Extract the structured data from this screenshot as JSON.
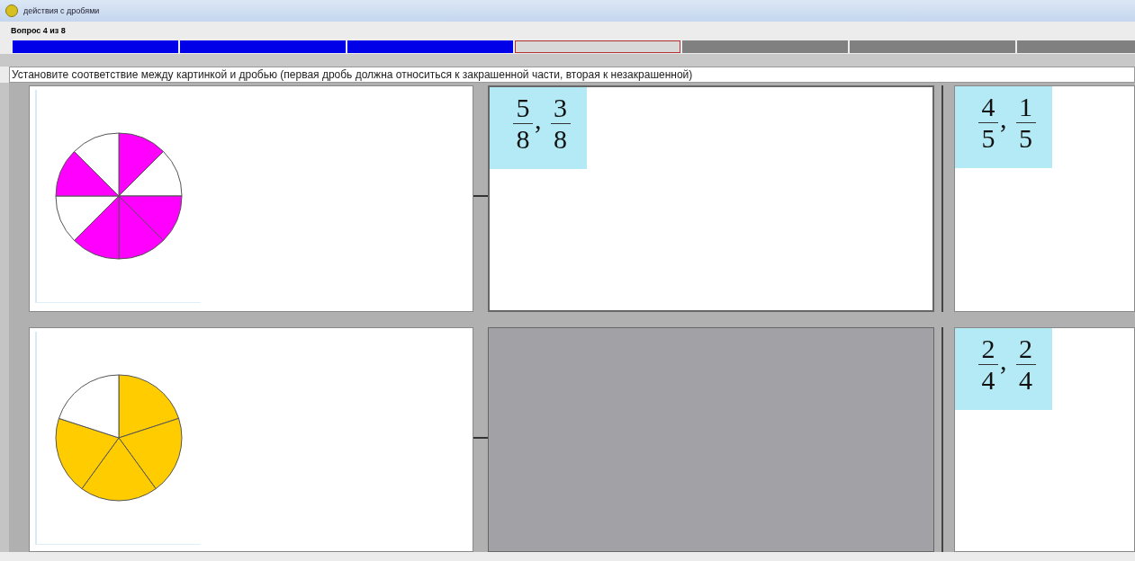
{
  "window": {
    "title": "действия с дробями"
  },
  "question": {
    "label": "Вопрос 4 из 8"
  },
  "progress": [
    {
      "done": true,
      "selected": false
    },
    {
      "done": true,
      "selected": false
    },
    {
      "done": true,
      "selected": false
    },
    {
      "done": false,
      "selected": true
    },
    {
      "done": false,
      "selected": false
    },
    {
      "done": false,
      "selected": false
    },
    {
      "done": false,
      "selected": false
    }
  ],
  "instruction": "Установите соответствие между картинкой и дробью (первая дробь должна относиться к закрашенной части, вторая к незакрашенной)",
  "rows": [
    {
      "picture": {
        "kind": "pie",
        "color": "#ff00ff",
        "slices": [
          true,
          false,
          true,
          true,
          true,
          false,
          true,
          false
        ]
      },
      "slot": {
        "card": {
          "fractions": [
            {
              "num": "5",
              "den": "8"
            },
            {
              "num": "3",
              "den": "8"
            }
          ],
          "separator": ","
        }
      },
      "option": {
        "fractions": [
          {
            "num": "4",
            "den": "5"
          },
          {
            "num": "1",
            "den": "5"
          }
        ],
        "separator": ","
      }
    },
    {
      "picture": {
        "kind": "pie",
        "color": "#ffcc00",
        "slices": [
          true,
          true,
          true,
          true,
          false
        ]
      },
      "slot": {},
      "option": {
        "fractions": [
          {
            "num": "2",
            "den": "4"
          },
          {
            "num": "2",
            "den": "4"
          }
        ],
        "separator": ","
      }
    }
  ]
}
